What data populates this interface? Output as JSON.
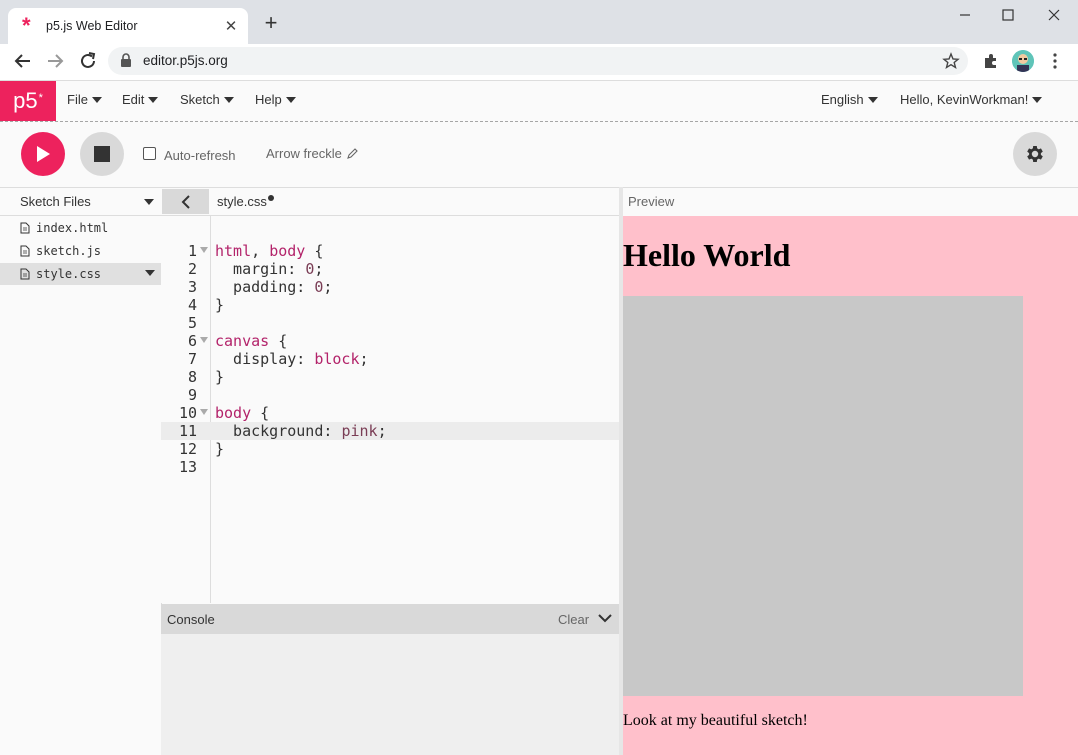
{
  "browser": {
    "tab_title": "p5.js Web Editor",
    "url": "editor.p5js.org"
  },
  "nav": {
    "logo": "p5",
    "logo_sup": "*",
    "menus": [
      "File",
      "Edit",
      "Sketch",
      "Help"
    ],
    "language": "English",
    "user": "Hello, KevinWorkman!"
  },
  "toolbar": {
    "auto_refresh_label": "Auto-refresh",
    "auto_refresh_checked": false,
    "sketch_name": "Arrow freckle"
  },
  "sidebar": {
    "title": "Sketch Files",
    "files": [
      "index.html",
      "sketch.js",
      "style.css"
    ],
    "selected_index": 2
  },
  "editor": {
    "filename": "style.css",
    "unsaved": true,
    "active_line": 11,
    "lines": [
      {
        "n": "1",
        "fold": true
      },
      {
        "n": "2"
      },
      {
        "n": "3"
      },
      {
        "n": "4"
      },
      {
        "n": "5"
      },
      {
        "n": "6",
        "fold": true
      },
      {
        "n": "7"
      },
      {
        "n": "8"
      },
      {
        "n": "9"
      },
      {
        "n": "10",
        "fold": true
      },
      {
        "n": "11"
      },
      {
        "n": "12"
      },
      {
        "n": "13"
      }
    ],
    "code": {
      "l1_kw1": "html",
      "l1_sep": ", ",
      "l1_kw2": "body",
      "l1_brace": " {",
      "l2_prop": "  margin: ",
      "l2_val": "0",
      "l2_end": ";",
      "l3_prop": "  padding: ",
      "l3_val": "0",
      "l3_end": ";",
      "l4": "}",
      "l6_kw": "canvas",
      "l6_brace": " {",
      "l7_prop": "  display: ",
      "l7_val": "block",
      "l7_end": ";",
      "l8": "}",
      "l10_kw": "body",
      "l10_brace": " {",
      "l11_prop": "  background: ",
      "l11_val": "pink",
      "l11_end": ";",
      "l12": "}"
    }
  },
  "console": {
    "title": "Console",
    "clear_label": "Clear"
  },
  "preview": {
    "title": "Preview",
    "heading": "Hello World",
    "caption": "Look at my beautiful sketch!",
    "background": "#ffc0cb",
    "canvas_color": "#c8c8c8"
  },
  "colors": {
    "accent": "#ed225d"
  }
}
